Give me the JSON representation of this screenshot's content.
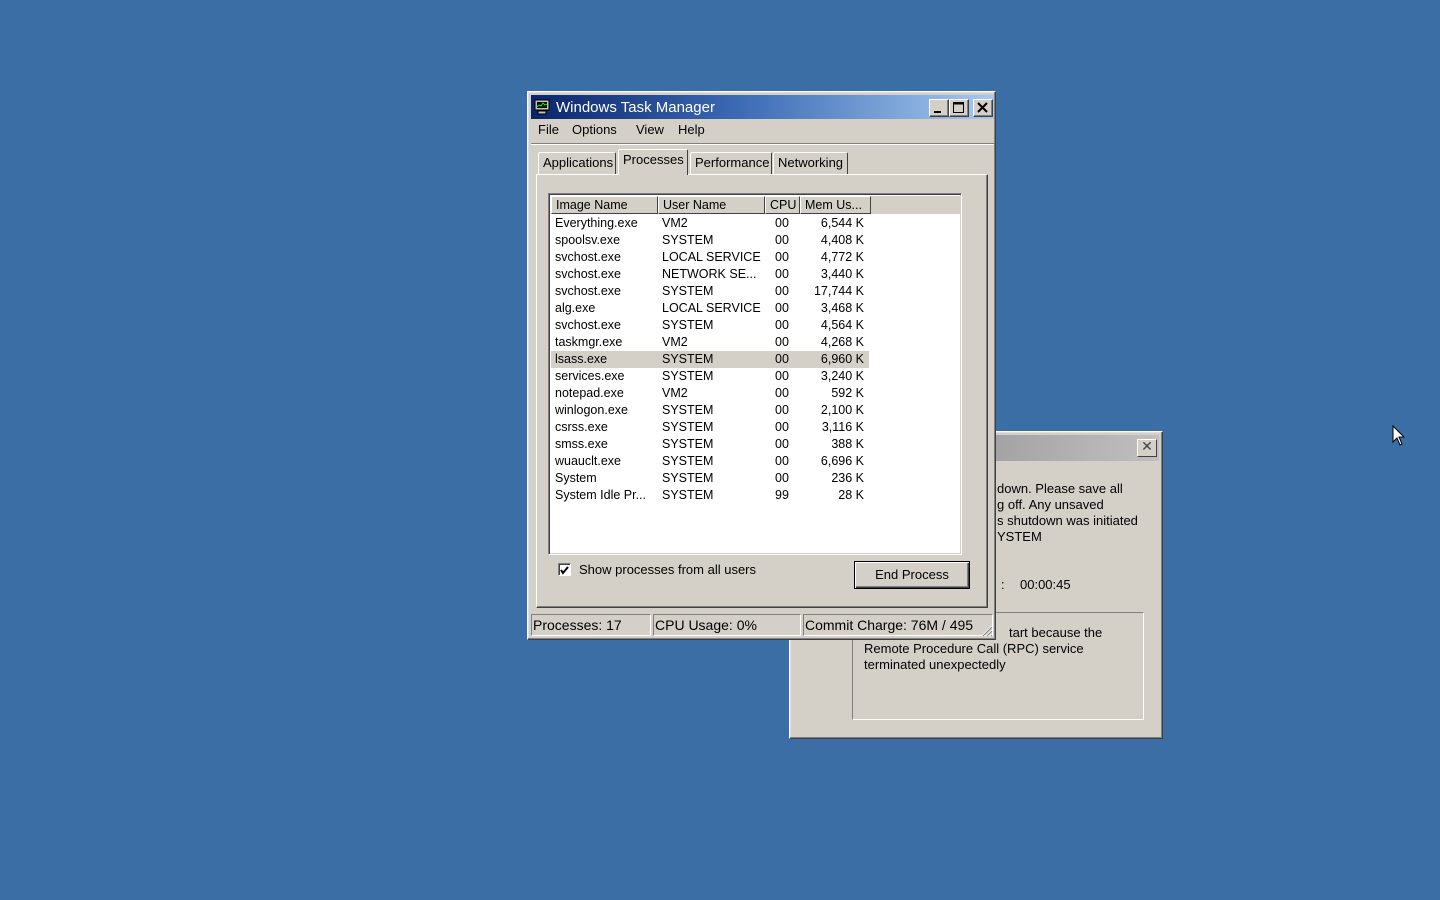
{
  "desktop": {
    "background_color": "#3a6ea5"
  },
  "shutdown_dialog": {
    "message_lines": [
      "down. Please save all",
      "g off. Any unsaved",
      "s shutdown was initiated",
      "YSTEM"
    ],
    "timer_colon": ":",
    "timer": "00:00:45",
    "reason_lines": [
      "tart because the",
      "Remote Procedure Call (RPC) service",
      "terminated unexpectedly"
    ]
  },
  "task_manager": {
    "title": "Windows Task Manager",
    "menu": [
      "File",
      "Options",
      "View",
      "Help"
    ],
    "tabs": [
      "Applications",
      "Processes",
      "Performance",
      "Networking"
    ],
    "active_tab": "Processes",
    "columns": [
      "Image Name",
      "User Name",
      "CPU",
      "Mem Us..."
    ],
    "processes": [
      {
        "name": "Everything.exe",
        "user": "VM2",
        "cpu": "00",
        "mem": "6,544 K"
      },
      {
        "name": "spoolsv.exe",
        "user": "SYSTEM",
        "cpu": "00",
        "mem": "4,408 K"
      },
      {
        "name": "svchost.exe",
        "user": "LOCAL SERVICE",
        "cpu": "00",
        "mem": "4,772 K"
      },
      {
        "name": "svchost.exe",
        "user": "NETWORK SE...",
        "cpu": "00",
        "mem": "3,440 K"
      },
      {
        "name": "svchost.exe",
        "user": "SYSTEM",
        "cpu": "00",
        "mem": "17,744 K"
      },
      {
        "name": "alg.exe",
        "user": "LOCAL SERVICE",
        "cpu": "00",
        "mem": "3,468 K"
      },
      {
        "name": "svchost.exe",
        "user": "SYSTEM",
        "cpu": "00",
        "mem": "4,564 K"
      },
      {
        "name": "taskmgr.exe",
        "user": "VM2",
        "cpu": "00",
        "mem": "4,268 K"
      },
      {
        "name": "lsass.exe",
        "user": "SYSTEM",
        "cpu": "00",
        "mem": "6,960 K",
        "selected": true
      },
      {
        "name": "services.exe",
        "user": "SYSTEM",
        "cpu": "00",
        "mem": "3,240 K"
      },
      {
        "name": "notepad.exe",
        "user": "VM2",
        "cpu": "00",
        "mem": "592 K"
      },
      {
        "name": "winlogon.exe",
        "user": "SYSTEM",
        "cpu": "00",
        "mem": "2,100 K"
      },
      {
        "name": "csrss.exe",
        "user": "SYSTEM",
        "cpu": "00",
        "mem": "3,116 K"
      },
      {
        "name": "smss.exe",
        "user": "SYSTEM",
        "cpu": "00",
        "mem": "388 K"
      },
      {
        "name": "wuauclt.exe",
        "user": "SYSTEM",
        "cpu": "00",
        "mem": "6,696 K"
      },
      {
        "name": "System",
        "user": "SYSTEM",
        "cpu": "00",
        "mem": "236 K"
      },
      {
        "name": "System Idle Pr...",
        "user": "SYSTEM",
        "cpu": "99",
        "mem": "28 K"
      }
    ],
    "show_all_users": {
      "label": "Show processes from all users",
      "checked": true
    },
    "end_process_label": "End Process",
    "status": {
      "processes": "Processes: 17",
      "cpu_usage": "CPU Usage: 0%",
      "commit_charge": "Commit Charge: 76M / 495"
    }
  }
}
